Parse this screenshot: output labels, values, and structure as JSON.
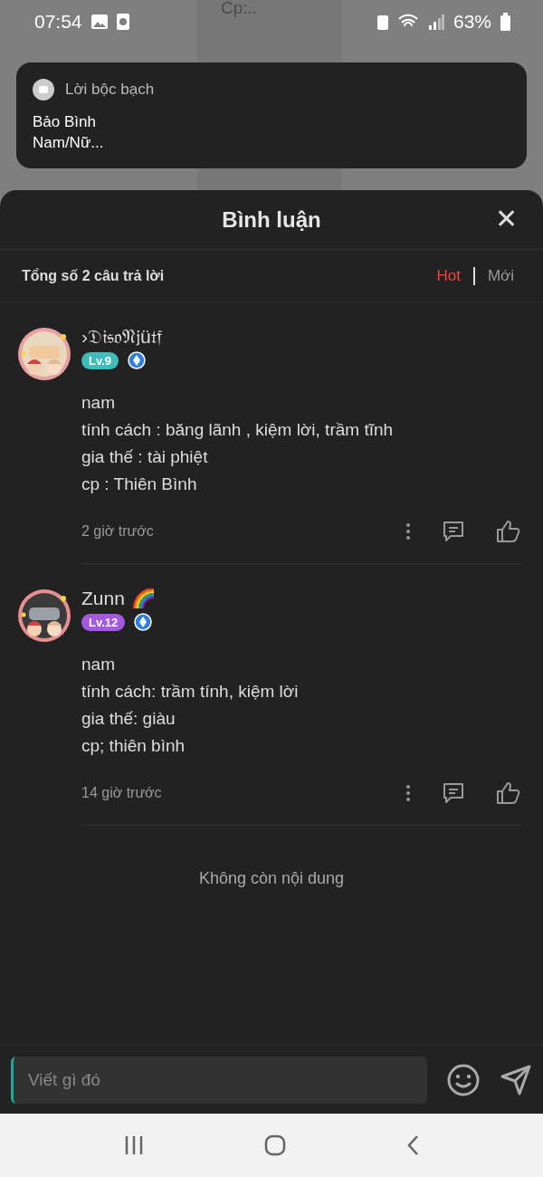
{
  "status_bar": {
    "time": "07:54",
    "battery": "63%"
  },
  "background_card": {
    "lines": [
      "Cp:.."
    ]
  },
  "notification": {
    "app": "Lời bộc bạch",
    "title": "Bảo Bình",
    "text": "Nam/Nữ..."
  },
  "sheet": {
    "title": "Bình luận",
    "close": "✕",
    "total": "Tổng số 2 câu trả lời",
    "sort_tabs": [
      {
        "label": "Hot",
        "selected": true
      },
      {
        "label": "Mới",
        "selected": false
      }
    ],
    "comments": [
      {
        "name": "›𝔇𝔦𝔰𝔬𝔑𝔧ü𝔱𝔣",
        "rainbow": false,
        "level": "Lv.9",
        "color": "#3fbcbc",
        "lines": [
          "nam",
          "tính cách : băng lãnh , kiệm lời, trầm tĩnh",
          "gia thế : tài phiệt",
          "cp : Thiên Bình"
        ],
        "time": "2 giờ trước"
      },
      {
        "name": "Zunn",
        "rainbow": true,
        "level": "Lv.12",
        "color": "#a559e0",
        "lines": [
          "nam",
          "tính cách: trầm tính, kiệm lời",
          "gia thế: giàu",
          "cp; thiên bình"
        ],
        "time": "14 giờ trước"
      }
    ],
    "end_text": "Không còn nội dung",
    "input": {
      "placeholder": "Viết gì đó"
    }
  }
}
